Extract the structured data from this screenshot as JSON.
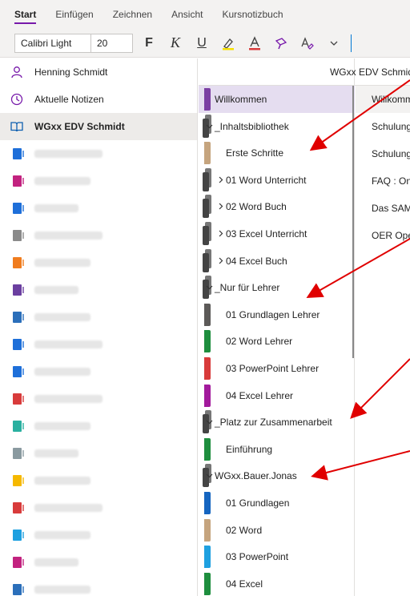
{
  "ribbon": {
    "tabs": [
      "Start",
      "Einfügen",
      "Zeichnen",
      "Ansicht",
      "Kursnotizbuch"
    ],
    "font_name": "Calibri Light",
    "font_size": "20",
    "bold": "F",
    "italic": "K",
    "underline": "U"
  },
  "left": {
    "user": "Henning Schmidt",
    "recent": "Aktuelle Notizen",
    "current_notebook": "WGxx EDV Schmidt"
  },
  "sections": {
    "header": "WGxx EDV Schmid",
    "items": [
      {
        "label": "Willkommen",
        "kind": "section",
        "color": "#7b3fa3",
        "active": true
      },
      {
        "label": "_Inhaltsbibliothek",
        "kind": "group-open"
      },
      {
        "label": "Erste Schritte",
        "kind": "section",
        "color": "#c5a47e"
      },
      {
        "label": "01 Word Unterricht",
        "kind": "group-closed"
      },
      {
        "label": "02 Word Buch",
        "kind": "group-closed"
      },
      {
        "label": "03 Excel Unterricht",
        "kind": "group-closed"
      },
      {
        "label": "04 Excel Buch",
        "kind": "group-closed"
      },
      {
        "label": "_Nur für Lehrer",
        "kind": "group-open"
      },
      {
        "label": "01 Grundlagen Lehrer",
        "kind": "section",
        "color": "#5c5a58"
      },
      {
        "label": "02 Word Lehrer",
        "kind": "section",
        "color": "#1e8e3e"
      },
      {
        "label": "03 PowerPoint Lehrer",
        "kind": "section",
        "color": "#d83b3b"
      },
      {
        "label": "04 Excel Lehrer",
        "kind": "section",
        "color": "#a21a9c"
      },
      {
        "label": "_Platz zur Zusammenarbeit",
        "kind": "group-open"
      },
      {
        "label": "Einführung",
        "kind": "section",
        "color": "#1e8e3e"
      },
      {
        "label": "WGxx.Bauer.Jonas",
        "kind": "group-open"
      },
      {
        "label": "01 Grundlagen",
        "kind": "section",
        "color": "#1565c0"
      },
      {
        "label": "02 Word",
        "kind": "section",
        "color": "#c5a47e"
      },
      {
        "label": "03 PowerPoint",
        "kind": "section",
        "color": "#1ea0e0"
      },
      {
        "label": "04 Excel",
        "kind": "section",
        "color": "#1e8e3e"
      }
    ]
  },
  "pages": [
    "Willkomm",
    "Schulung",
    "Schulung",
    "FAQ : On",
    "Das SAM",
    "OER Ope"
  ],
  "notebook_colors": [
    "#1e6fd9",
    "#c2227f",
    "#1e6fd9",
    "#8a8a8a",
    "#f07c1e",
    "#6b3fa0",
    "#2b6fba",
    "#1e6fd9",
    "#1e6fd9",
    "#d83b3b",
    "#2ab0a0",
    "#8a9aa0",
    "#f5b800",
    "#d83b3b",
    "#1ea0e0",
    "#c2227f",
    "#2b6fba"
  ],
  "colors": {
    "accent": "#7719aa",
    "annotation": "#e00000"
  }
}
